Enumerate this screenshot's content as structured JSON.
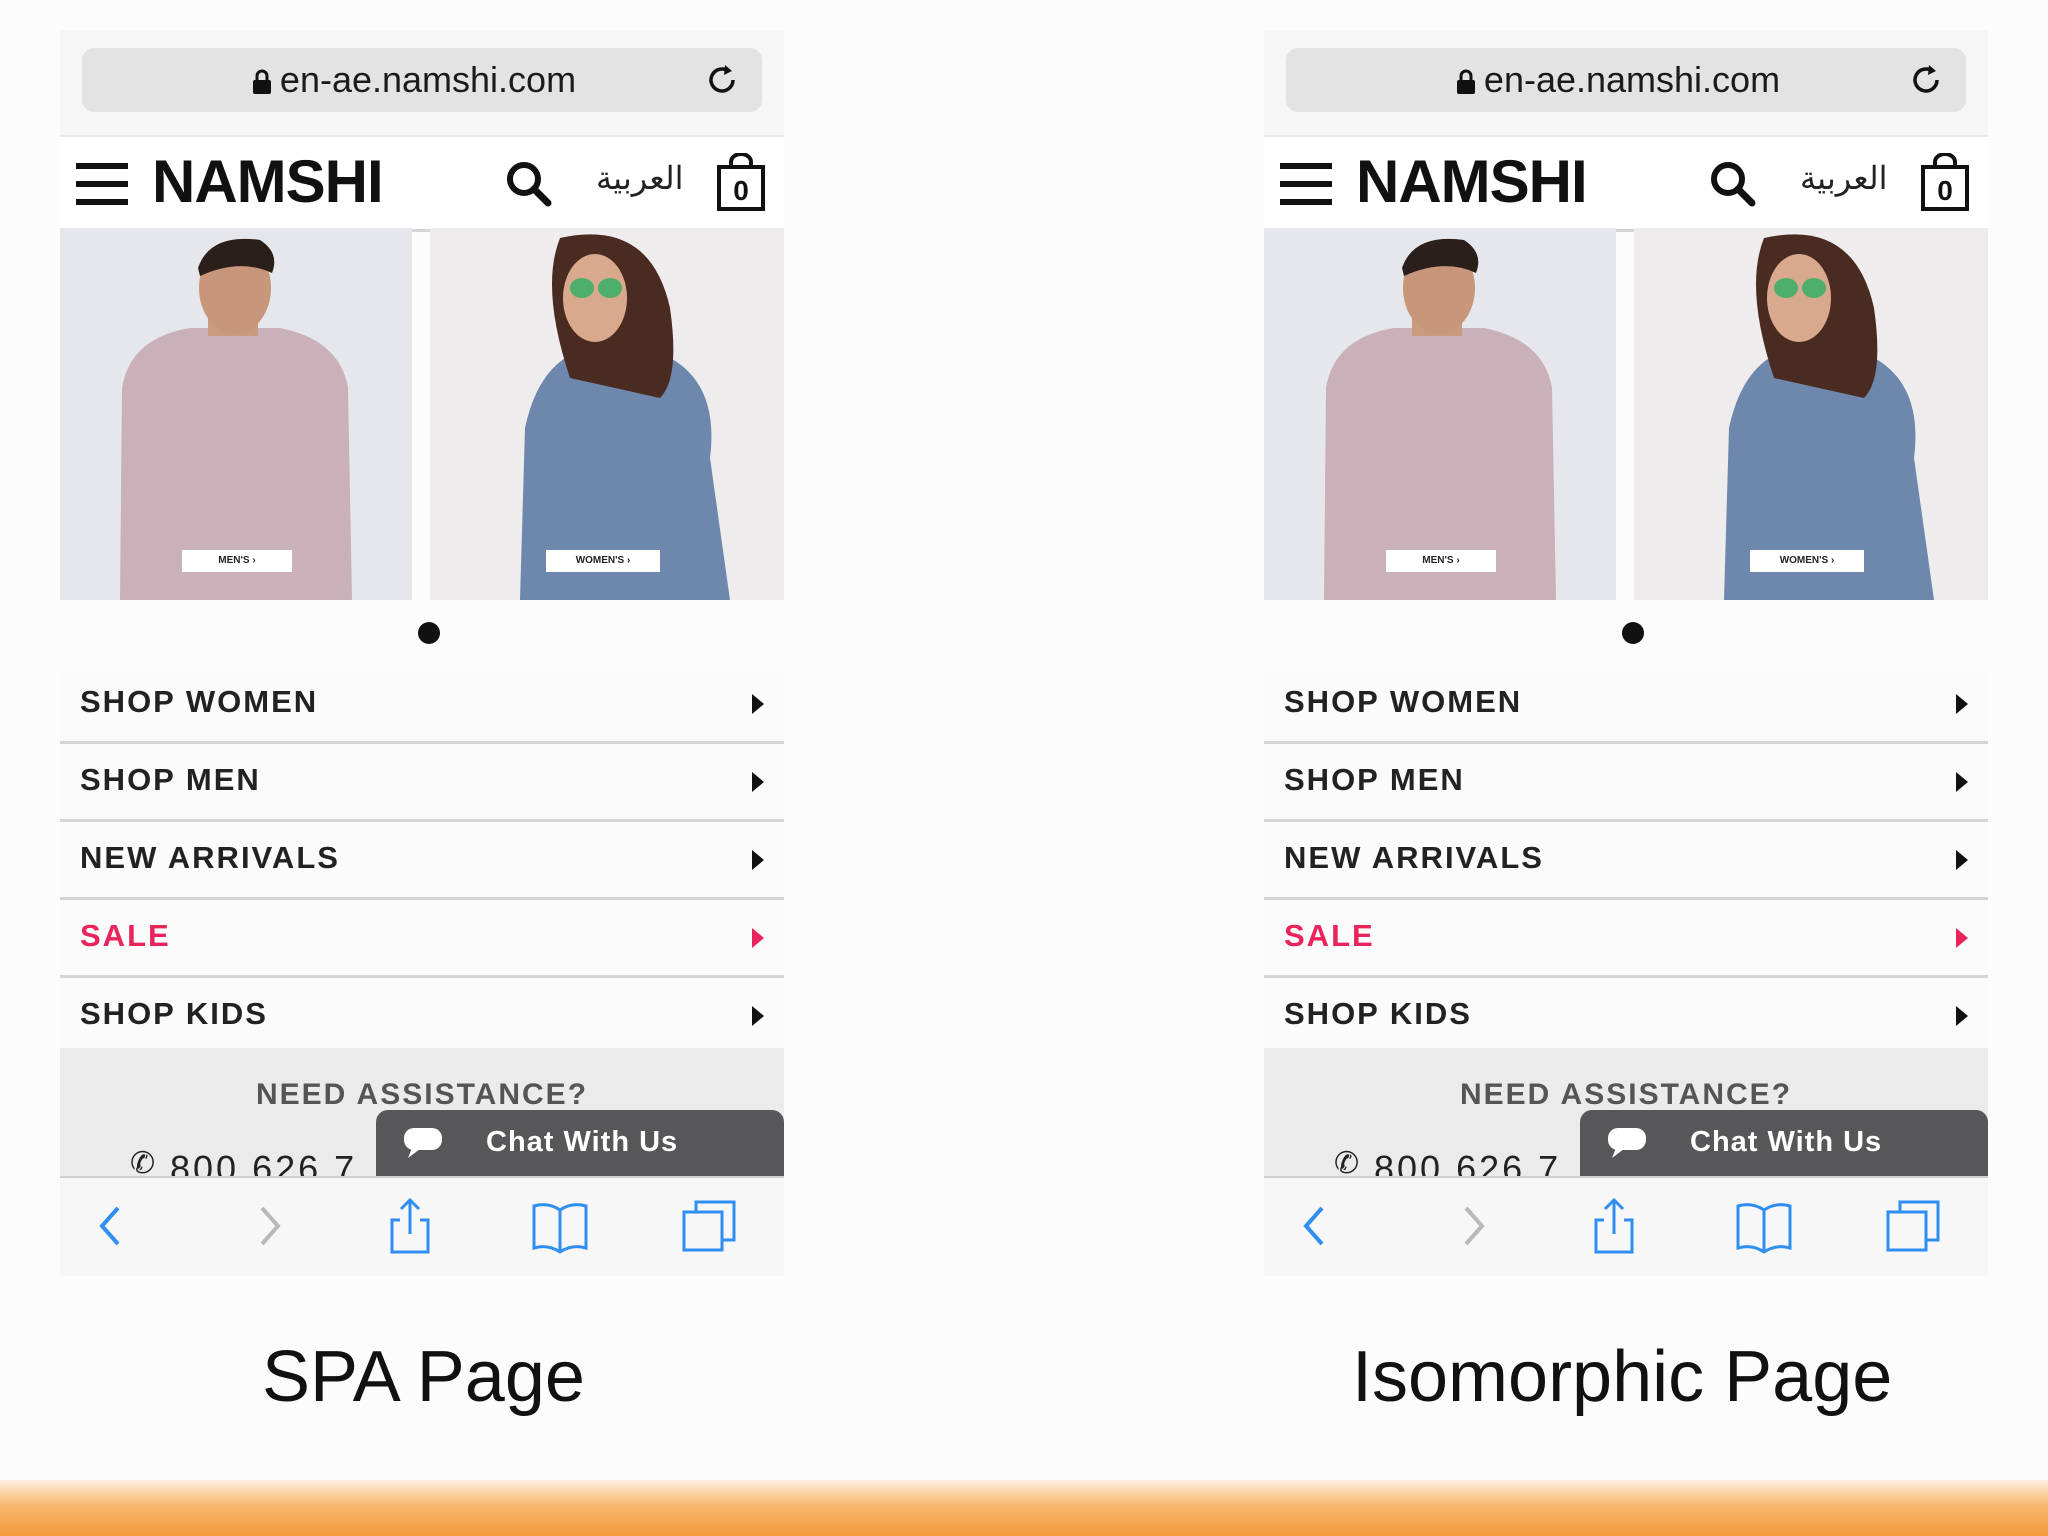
{
  "pages": [
    {
      "url": "en-ae.namshi.com",
      "brand": "NAMSHI",
      "language_link": "العربية",
      "cart_count": "0",
      "banner_tags": {
        "men": "MEN'S ›",
        "women": "WOMEN'S ›"
      },
      "menu": [
        {
          "label": "SHOP WOMEN"
        },
        {
          "label": "SHOP MEN"
        },
        {
          "label": "NEW ARRIVALS"
        },
        {
          "label": "SALE"
        },
        {
          "label": "SHOP KIDS"
        }
      ],
      "assistance_title": "NEED ASSISTANCE?",
      "phone_number": "800 626 7",
      "chat_label": "Chat With Us",
      "caption": "SPA Page"
    },
    {
      "url": "en-ae.namshi.com",
      "brand": "NAMSHI",
      "language_link": "العربية",
      "cart_count": "0",
      "banner_tags": {
        "men": "MEN'S ›",
        "women": "WOMEN'S ›"
      },
      "menu": [
        {
          "label": "SHOP WOMEN"
        },
        {
          "label": "SHOP MEN"
        },
        {
          "label": "NEW ARRIVALS"
        },
        {
          "label": "SALE"
        },
        {
          "label": "SHOP KIDS"
        }
      ],
      "assistance_title": "NEED ASSISTANCE?",
      "phone_number": "800 626 7",
      "chat_label": "Chat With Us",
      "caption": "Isomorphic Page"
    }
  ],
  "colors": {
    "sale": "#e8245a",
    "ios_blue": "#2f8ef0",
    "chat_bg": "#575759",
    "accent_bar": "#f39a3c"
  },
  "icons": [
    "lock-icon",
    "reload-icon",
    "hamburger-icon",
    "search-icon",
    "shopping-bag-icon",
    "chat-bubble-icon",
    "phone-icon",
    "back-icon",
    "forward-icon",
    "share-icon",
    "bookmarks-icon",
    "tabs-icon"
  ]
}
